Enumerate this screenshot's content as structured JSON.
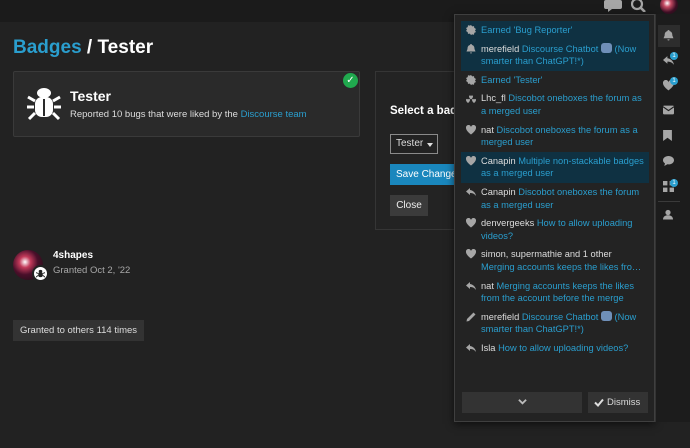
{
  "header": {
    "chat_icon": "chat-bubble-icon",
    "search_icon": "search-icon",
    "avatar_icon": "user-avatar"
  },
  "page": {
    "breadcrumb_badges": "Badges",
    "breadcrumb_separator": " / ",
    "title": "Tester"
  },
  "badge": {
    "name": "Tester",
    "description_prefix": "Reported 10 bugs that were liked by the ",
    "description_link": "Discourse team",
    "icon": "bug-icon",
    "granted_check": "check-icon"
  },
  "select_badge": {
    "title": "Select a badge",
    "selected": "Tester",
    "save_label": "Save Changes",
    "close_label": "Close"
  },
  "granted": {
    "username": "4shapes",
    "date": "Granted Oct 2, '22"
  },
  "granted_others": "Granted to others 114 times",
  "notifications": [
    {
      "icon": "badge-icon",
      "who": "",
      "text": "Earned 'Bug Reporter'",
      "highlight": true
    },
    {
      "icon": "bell-icon",
      "who": "merefield",
      "text": "Discourse Chatbot",
      "emoji": "robot-emoji",
      "text2": "(Now smarter than ChatGPT!*)",
      "highlight": true
    },
    {
      "icon": "badge-icon",
      "who": "",
      "text": "Earned 'Tester'",
      "highlight": false
    },
    {
      "icon": "heart-multiple-icon",
      "who": "Lhc_fl",
      "text": "Discobot oneboxes the forum as a merged user",
      "highlight": false
    },
    {
      "icon": "heart-icon",
      "who": "nat",
      "text": "Discobot oneboxes the forum as a merged user",
      "highlight": false
    },
    {
      "icon": "heart-icon",
      "who": "Canapin",
      "text": "Multiple non-stackable badges as a merged user",
      "highlight": true
    },
    {
      "icon": "reply-icon",
      "who": "Canapin",
      "text": "Discobot oneboxes the forum as a merged user",
      "highlight": false
    },
    {
      "icon": "heart-icon",
      "who": "denvergeeks",
      "text": "How to allow uploading videos?",
      "highlight": false
    },
    {
      "icon": "heart-icon",
      "who": "simon, supermathie and 1 other",
      "text": "Merging accounts keeps the likes fro…",
      "highlight": false
    },
    {
      "icon": "reply-icon",
      "who": "nat",
      "text": "Merging accounts keeps the likes from the account before the merge",
      "highlight": false
    },
    {
      "icon": "pencil-icon",
      "who": "merefield",
      "text": "Discourse Chatbot",
      "emoji": "robot-emoji",
      "text2": "(Now smarter than ChatGPT!*)",
      "highlight": false
    },
    {
      "icon": "reply-icon",
      "who": "Isla",
      "text": "How to allow uploading videos?",
      "highlight": false
    }
  ],
  "notif_footer": {
    "more_icon": "chevron-down-icon",
    "dismiss_label": "Dismiss",
    "dismiss_icon": "check-icon"
  },
  "rail": {
    "items": [
      {
        "icon": "bell-icon",
        "badge": ""
      },
      {
        "icon": "reply-icon",
        "badge": "1"
      },
      {
        "icon": "heart-icon",
        "badge": "1"
      },
      {
        "icon": "envelope-icon",
        "badge": ""
      },
      {
        "icon": "bookmark-icon",
        "badge": ""
      },
      {
        "icon": "chat-icon",
        "badge": ""
      },
      {
        "icon": "review-icon",
        "badge": "1"
      },
      {
        "icon": "user-icon",
        "badge": ""
      }
    ]
  },
  "colors": {
    "background": "#222222",
    "link": "#2a9ece",
    "primary_button": "#1a87bd",
    "highlight_row": "#0f3142",
    "check_green": "#20a94e"
  }
}
